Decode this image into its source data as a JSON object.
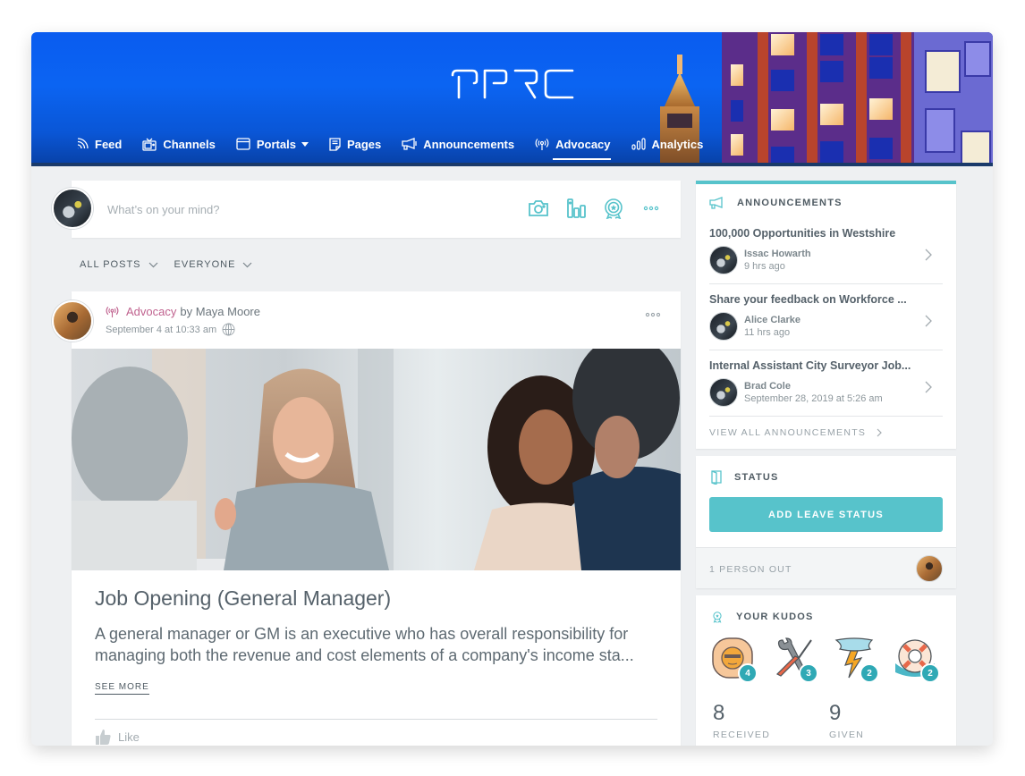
{
  "brand": {
    "logo_text": "OPRO",
    "accent": "#57c3cb",
    "header_blue": "#0a5cf0",
    "category_pink": "#c0638f"
  },
  "nav": {
    "items": [
      {
        "label": "Feed",
        "icon": "rss-icon"
      },
      {
        "label": "Channels",
        "icon": "tv-icon"
      },
      {
        "label": "Portals",
        "icon": "window-icon",
        "dropdown": true
      },
      {
        "label": "Pages",
        "icon": "page-icon"
      },
      {
        "label": "Announcements",
        "icon": "megaphone-icon"
      },
      {
        "label": "Advocacy",
        "icon": "broadcast-icon",
        "active": true
      },
      {
        "label": "Analytics",
        "icon": "bar-chart-icon"
      }
    ]
  },
  "composer": {
    "placeholder": "What’s on your mind?",
    "value": "",
    "actions": [
      "camera-icon",
      "poll-icon",
      "award-icon",
      "more-icon"
    ]
  },
  "filters": {
    "posts": "ALL POSTS",
    "audience": "EVERYONE"
  },
  "post": {
    "category": "Advocacy",
    "by": "by",
    "author": "Maya Moore",
    "timestamp": "September 4 at 10:33 am",
    "visibility_icon": "globe-icon",
    "title": "Job Opening (General Manager)",
    "text": "A general manager or GM is an executive who has overall responsibility for managing both the revenue and cost elements of a company's income sta...",
    "see_more": "SEE MORE",
    "like_label": "Like"
  },
  "announcements": {
    "title": "ANNOUNCEMENTS",
    "items": [
      {
        "title": "100,000 Opportunities in Westshire",
        "author": "Issac Howarth",
        "time": "9 hrs ago"
      },
      {
        "title": "Share your feedback on Workforce ...",
        "author": "Alice Clarke",
        "time": "11 hrs ago"
      },
      {
        "title": "Internal Assistant City Surveyor Job...",
        "author": "Brad Cole",
        "time": "September 28, 2019 at 5:26 am"
      }
    ],
    "view_all": "VIEW ALL ANNOUNCEMENTS"
  },
  "status": {
    "title": "STATUS",
    "button": "ADD LEAVE STATUS",
    "out_label": "1 PERSON OUT"
  },
  "kudos": {
    "title": "YOUR KUDOS",
    "badges": [
      {
        "name": "sun-badge",
        "count": "4"
      },
      {
        "name": "tools-badge",
        "count": "3"
      },
      {
        "name": "storm-badge",
        "count": "2"
      },
      {
        "name": "lifebuoy-badge",
        "count": "2"
      }
    ],
    "received": {
      "value": "8",
      "label": "RECEIVED"
    },
    "given": {
      "value": "9",
      "label": "GIVEN"
    }
  }
}
